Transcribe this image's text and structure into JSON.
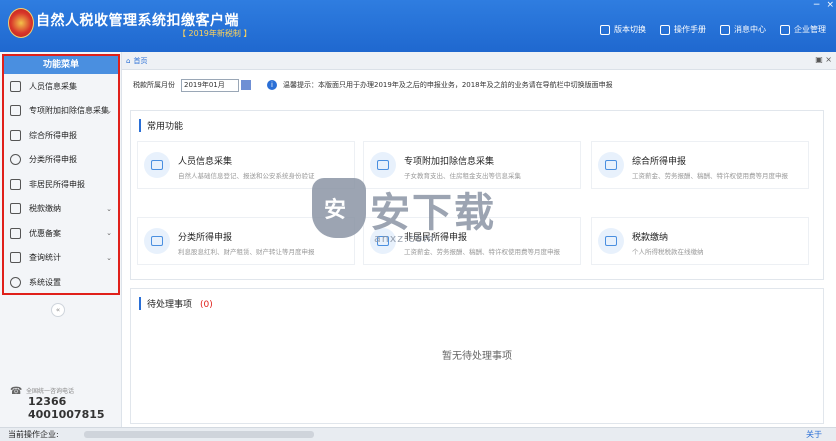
{
  "app": {
    "title": "自然人税收管理系统扣缴客户端",
    "subtitle": "【 2019年新税制 】"
  },
  "topnav": [
    {
      "label": "版本切换",
      "icon": "switch-version-icon"
    },
    {
      "label": "操作手册",
      "icon": "manual-icon"
    },
    {
      "label": "消息中心",
      "icon": "message-icon"
    },
    {
      "label": "企业管理",
      "icon": "enterprise-icon"
    }
  ],
  "window_buttons": [
    "−",
    "×"
  ],
  "sidebar": {
    "header": "功能菜单",
    "items": [
      {
        "label": "人员信息采集",
        "icon": "person-icon",
        "expandable": false
      },
      {
        "label": "专项附加扣除信息采集",
        "icon": "list-icon",
        "expandable": true
      },
      {
        "label": "综合所得申报",
        "icon": "layers-icon",
        "expandable": false
      },
      {
        "label": "分类所得申报",
        "icon": "pie-icon",
        "expandable": false
      },
      {
        "label": "非居民所得申报",
        "icon": "person-outline-icon",
        "expandable": false
      },
      {
        "label": "税款缴纳",
        "icon": "folder-icon",
        "expandable": true
      },
      {
        "label": "优惠备案",
        "icon": "document-icon",
        "expandable": true
      },
      {
        "label": "查询统计",
        "icon": "search-list-icon",
        "expandable": true
      },
      {
        "label": "系统设置",
        "icon": "gear-icon",
        "expandable": false
      }
    ],
    "collapse_label": "«",
    "hotline": {
      "label": "全国统一咨询电话",
      "numbers": [
        "12366",
        "4001007815"
      ]
    }
  },
  "tabs": {
    "home_label": "首页",
    "tools": "▣ ×"
  },
  "period": {
    "label": "税款所属月份",
    "value": "2019年01月",
    "tip": "温馨提示：本版面只用于办理2019年及之后的申报业务，2018年及之前的业务请在导航栏中切换版面申报"
  },
  "common": {
    "title": "常用功能",
    "cards": [
      {
        "title": "人员信息采集",
        "desc": "自然人基础信息登记、报送和公安系统身份验证"
      },
      {
        "title": "专项附加扣除信息采集",
        "desc": "子女教育支出、住房租金支出等信息采集"
      },
      {
        "title": "综合所得申报",
        "desc": "工资薪金、劳务报酬、稿酬、特许权使用费等月度申报"
      },
      {
        "title": "分类所得申报",
        "desc": "利息股息红利、财产租赁、财产转让等月度申报"
      },
      {
        "title": "非居民所得申报",
        "desc": "工资薪金、劳务报酬、稿酬、特许权使用费等月度申报"
      },
      {
        "title": "税款缴纳",
        "desc": "个人所得税税款在线缴纳"
      }
    ]
  },
  "pending": {
    "title": "待处理事项",
    "count": "(0)",
    "empty": "暂无待处理事项"
  },
  "watermark": {
    "mark": "安",
    "text": "安下载",
    "url": "anxz.com"
  },
  "status": {
    "label": "当前操作企业:",
    "about": "关于"
  },
  "colors": {
    "titlebar": "#2f7de0",
    "accent": "#2a6fd6",
    "highlight_border": "#e0201a"
  }
}
